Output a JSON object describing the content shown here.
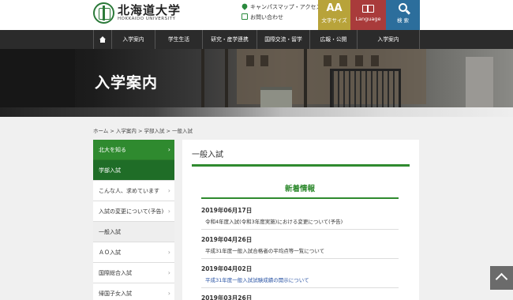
{
  "header": {
    "logo_name": "北海道大学",
    "logo_sub": "HOKKAIDO UNIVERSITY",
    "util_links": [
      "キャンパスマップ・アクセス",
      "お問い合わせ"
    ],
    "buttons": {
      "font_size_glyph": "AA",
      "font_size_label": "文字サイズ",
      "language_label": "Language",
      "search_label": "検 索"
    }
  },
  "nav": {
    "items": [
      "入学案内",
      "学生生活",
      "研究・産学連携",
      "国際交流・留学",
      "広報・公開",
      "入学案内"
    ]
  },
  "hero": {
    "title": "入学案内"
  },
  "breadcrumb": {
    "text": "ホーム > 入学案内 > 学部入試 > 一般入試"
  },
  "sidebar": {
    "items": [
      "北大を知る",
      "学部入試",
      "こんな人、求めています",
      "入試の変更について(予告)",
      "一般入試",
      "ＡＯ入試",
      "国際総合入試",
      "帰国子女入試"
    ]
  },
  "main": {
    "title": "一般入試",
    "news_title": "新着情報",
    "news": [
      {
        "date": "2019年06月17日",
        "text": "令和4年度入試(令和3年度実施)における変更について(予告)"
      },
      {
        "date": "2019年04月26日",
        "text": "平成31年度一般入試合格者の平均点等一覧について"
      },
      {
        "date": "2019年04月02日",
        "text": "平成31年度一般入試試験成績の開示について"
      },
      {
        "date": "2019年03月26日",
        "text": ""
      }
    ]
  },
  "colors": {
    "green": "#2f8a2f",
    "font_btn": "#b8a33a",
    "lang_btn": "#a93b3b",
    "search_btn": "#2c6e9c",
    "nav_bg": "#2b2b2b"
  }
}
